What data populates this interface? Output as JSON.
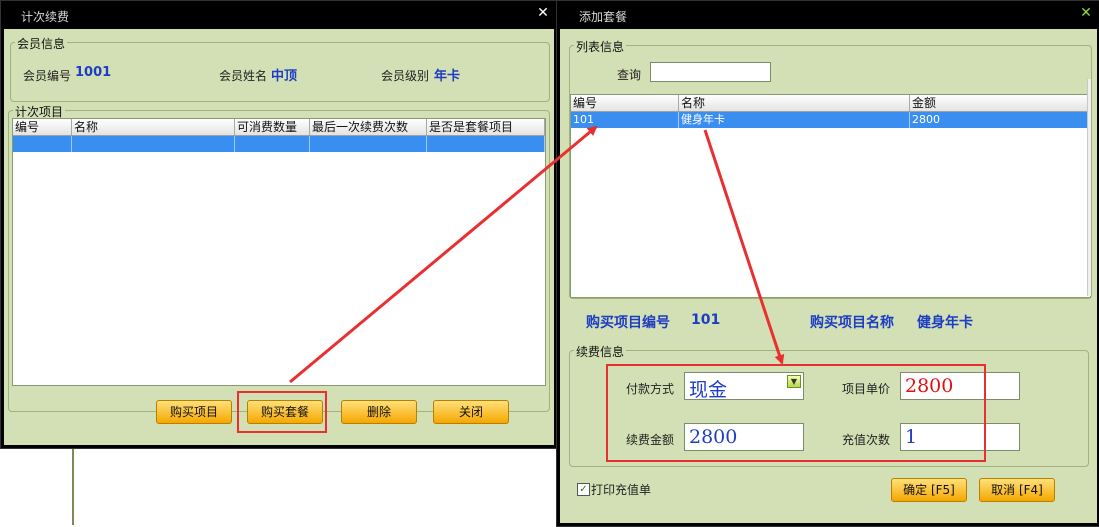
{
  "left_window": {
    "title": "计次续费",
    "member_group": "会员信息",
    "member_no_label": "会员编号",
    "member_no": "1001",
    "member_name_label": "会员姓名",
    "member_name": "中顶",
    "member_level_label": "会员级别",
    "member_level": "年卡",
    "items_group": "计次项目",
    "columns": [
      "编号",
      "名称",
      "可消费数量",
      "最后一次续费次数",
      "是否是套餐项目"
    ],
    "buttons": {
      "buy_item": "购买项目",
      "buy_package": "购买套餐",
      "delete": "删除",
      "close": "关闭"
    }
  },
  "right_window": {
    "title": "添加套餐",
    "list_group": "列表信息",
    "query_label": "查询",
    "query_value": "",
    "columns": [
      "编号",
      "名称",
      "金额"
    ],
    "rows": [
      {
        "id": "101",
        "name": "健身年卡",
        "amount": "2800"
      }
    ],
    "purchase_no_label": "购买项目编号",
    "purchase_no": "101",
    "purchase_name_label": "购买项目名称",
    "purchase_name": "健身年卡",
    "renew_group": "续费信息",
    "payment_label": "付款方式",
    "payment_value": "现金",
    "unit_price_label": "项目单价",
    "unit_price": "2800",
    "renew_amount_label": "续费金额",
    "renew_amount": "2800",
    "recharge_count_label": "充值次数",
    "recharge_count": "1",
    "print_label": "打印充值单",
    "print_checked": true,
    "ok_label": "确定 [F5]",
    "cancel_label": "取消 [F4]"
  },
  "colors": {
    "accent_blue": "#1d3dc4",
    "price_red": "#e01010",
    "annotation_red": "#e83030",
    "selection": "#3a8ef0",
    "panel": "#d3dfb4"
  },
  "icons": {
    "close": "close-icon",
    "dropdown": "chevron-down-icon",
    "check": "check-icon"
  }
}
